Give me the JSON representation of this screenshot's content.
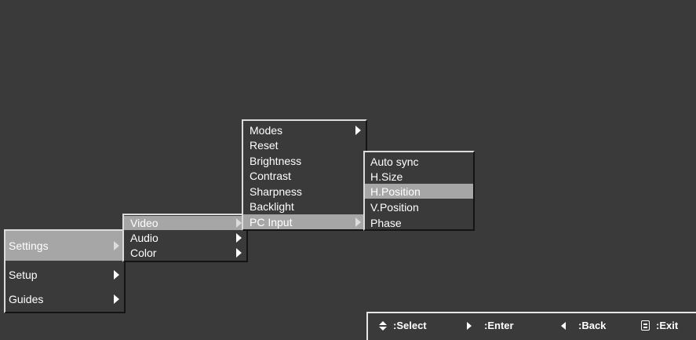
{
  "main_menu": {
    "items": [
      {
        "label": "Settings",
        "selected": true
      },
      {
        "label": "Setup",
        "selected": false
      },
      {
        "label": "Guides",
        "selected": false
      }
    ]
  },
  "settings_menu": {
    "items": [
      {
        "label": "Video",
        "selected": true
      },
      {
        "label": "Audio",
        "selected": false
      },
      {
        "label": "Color",
        "selected": false
      }
    ]
  },
  "video_menu": {
    "items": [
      {
        "label": "Modes",
        "has_submenu": true,
        "selected": false
      },
      {
        "label": "Reset",
        "has_submenu": false,
        "selected": false
      },
      {
        "label": "Brightness",
        "has_submenu": false,
        "selected": false
      },
      {
        "label": "Contrast",
        "has_submenu": false,
        "selected": false
      },
      {
        "label": "Sharpness",
        "has_submenu": false,
        "selected": false
      },
      {
        "label": "Backlight",
        "has_submenu": false,
        "selected": false
      },
      {
        "label": "PC Input",
        "has_submenu": true,
        "selected": true
      }
    ]
  },
  "pc_input_menu": {
    "items": [
      {
        "label": "Auto sync",
        "selected": false
      },
      {
        "label": "H.Size",
        "selected": false
      },
      {
        "label": "H.Position",
        "selected": true
      },
      {
        "label": "V.Position",
        "selected": false
      },
      {
        "label": "Phase",
        "selected": false
      }
    ]
  },
  "hints": {
    "select": ":Select",
    "enter": ":Enter",
    "back": ":Back",
    "exit": ":Exit"
  },
  "colors": {
    "background": "#3a3a3a",
    "selected_item": "#a6a6a6",
    "text": "#ffffff"
  }
}
